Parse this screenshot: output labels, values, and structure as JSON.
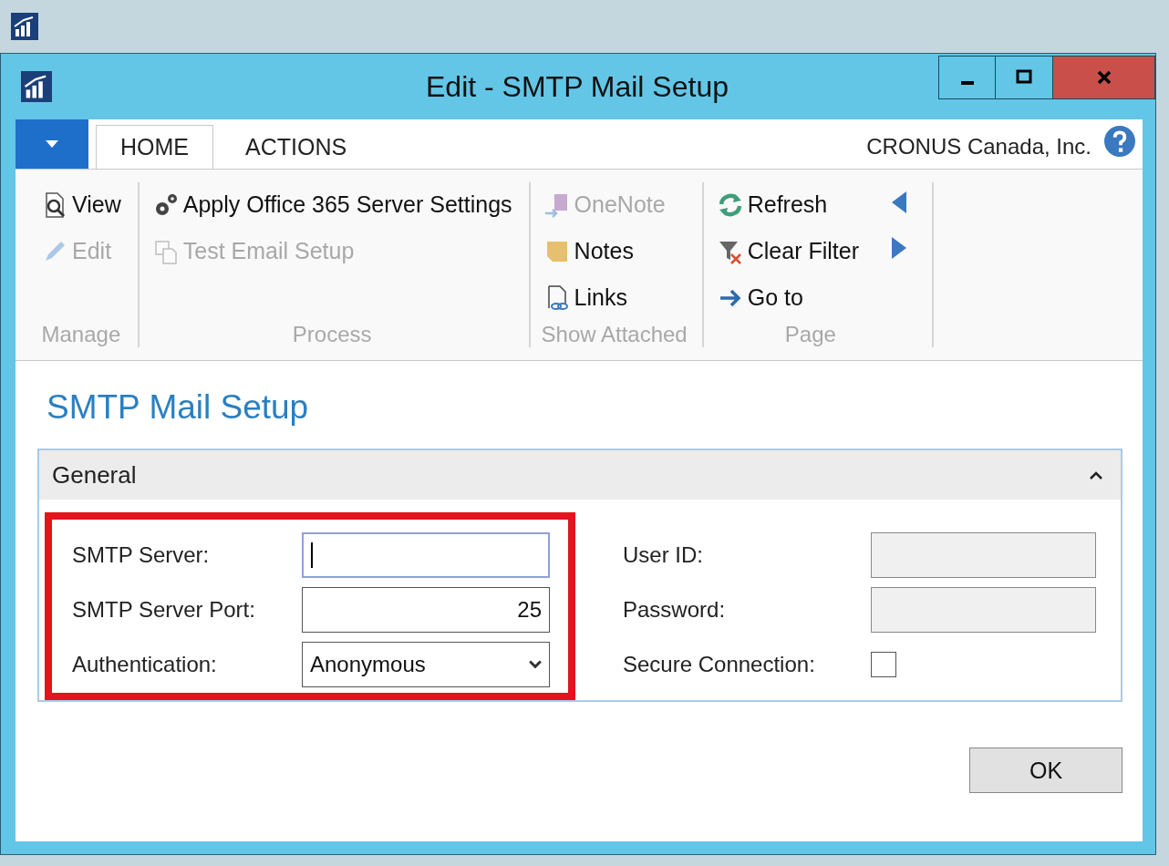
{
  "window": {
    "title": "Edit - SMTP Mail Setup"
  },
  "ribbon": {
    "tabs": [
      {
        "label": "HOME",
        "selected": true
      },
      {
        "label": "ACTIONS",
        "selected": false
      }
    ],
    "company": "CRONUS Canada, Inc.",
    "groups": [
      {
        "label": "Manage",
        "actions": [
          {
            "label": "View",
            "kind": "view",
            "disabled": false
          },
          {
            "label": "Edit",
            "kind": "edit",
            "disabled": true
          }
        ]
      },
      {
        "label": "Process",
        "actions": [
          {
            "label": "Apply Office 365 Server Settings",
            "kind": "gears",
            "disabled": false
          },
          {
            "label": "Test Email Setup",
            "kind": "test",
            "disabled": true
          }
        ]
      },
      {
        "label": "Show Attached",
        "actions": [
          {
            "label": "OneNote",
            "kind": "onenote",
            "disabled": true
          },
          {
            "label": "Notes",
            "kind": "notes",
            "disabled": false
          },
          {
            "label": "Links",
            "kind": "links",
            "disabled": false
          }
        ]
      },
      {
        "label": "Page",
        "actions": [
          {
            "label": "Refresh",
            "kind": "refresh",
            "disabled": false
          },
          {
            "label": "Clear Filter",
            "kind": "filter",
            "disabled": false
          },
          {
            "label": "Go to",
            "kind": "goto",
            "disabled": false
          }
        ]
      }
    ]
  },
  "page_title": "SMTP Mail Setup",
  "section": {
    "title": "General",
    "expanded": true,
    "left_highlighted": true,
    "left_fields": [
      {
        "label": "SMTP Server:",
        "kind": "text",
        "focused": true
      },
      {
        "label": "SMTP Server Port:",
        "kind": "number",
        "value": "25",
        "focused": false
      },
      {
        "label": "Authentication:",
        "kind": "select",
        "value": "Anonymous",
        "focused": false
      }
    ],
    "right_fields": [
      {
        "label": "User ID:",
        "kind": "text",
        "disabled": true
      },
      {
        "label": "Password:",
        "kind": "text",
        "disabled": true
      },
      {
        "label": "Secure Connection:",
        "kind": "checkbox",
        "checked": false
      }
    ]
  },
  "buttons": [
    {
      "label": "OK"
    }
  ]
}
